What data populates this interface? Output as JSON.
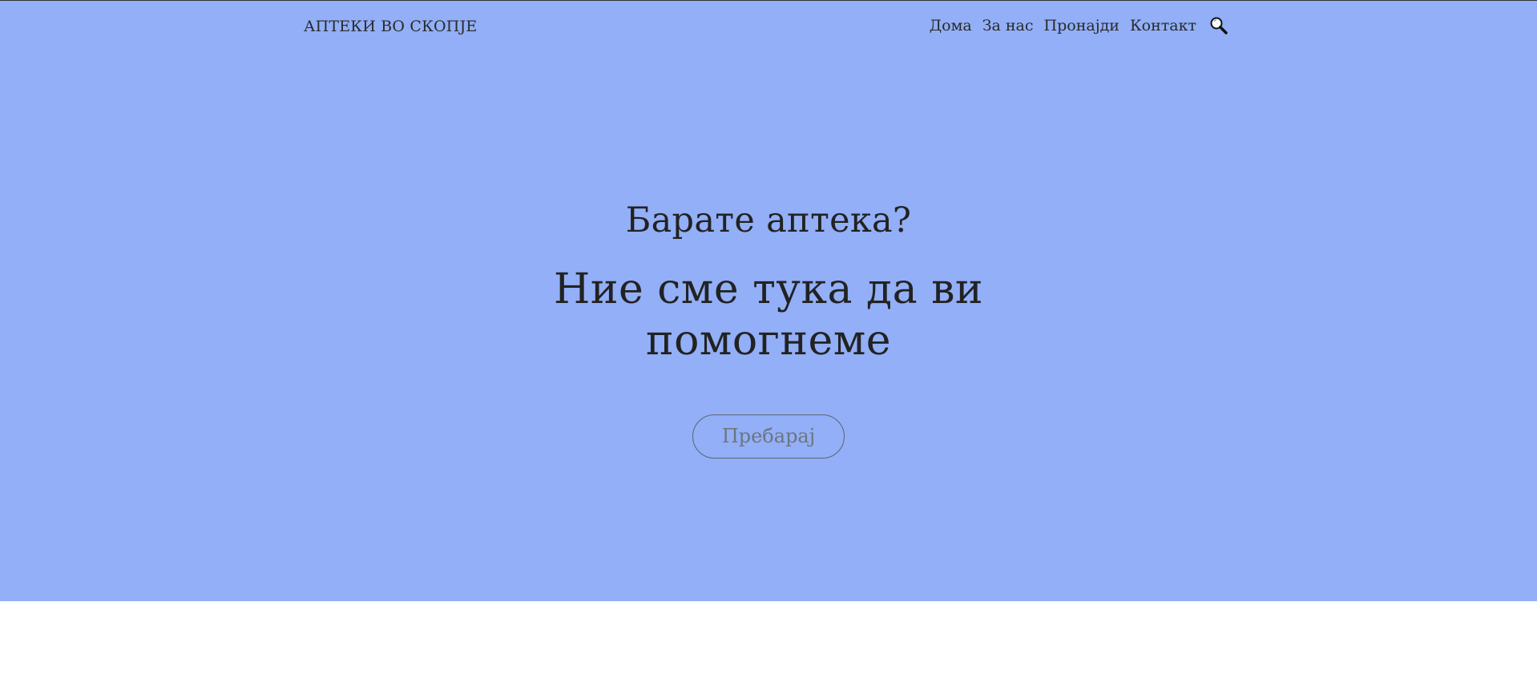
{
  "header": {
    "brand": "АПТЕКИ ВО СКОПЈЕ",
    "nav": [
      {
        "label": "Дома"
      },
      {
        "label": "За нас"
      },
      {
        "label": "Пронајди"
      },
      {
        "label": "Контакт"
      }
    ],
    "search_icon": "search-icon"
  },
  "hero": {
    "subtitle": "Барате аптека?",
    "headline": "Ние сме тука да ви помогнеме",
    "button_label": "Пребарај"
  },
  "colors": {
    "hero_background": "#92aff7",
    "text": "#222222",
    "button_text": "#6c757d"
  }
}
